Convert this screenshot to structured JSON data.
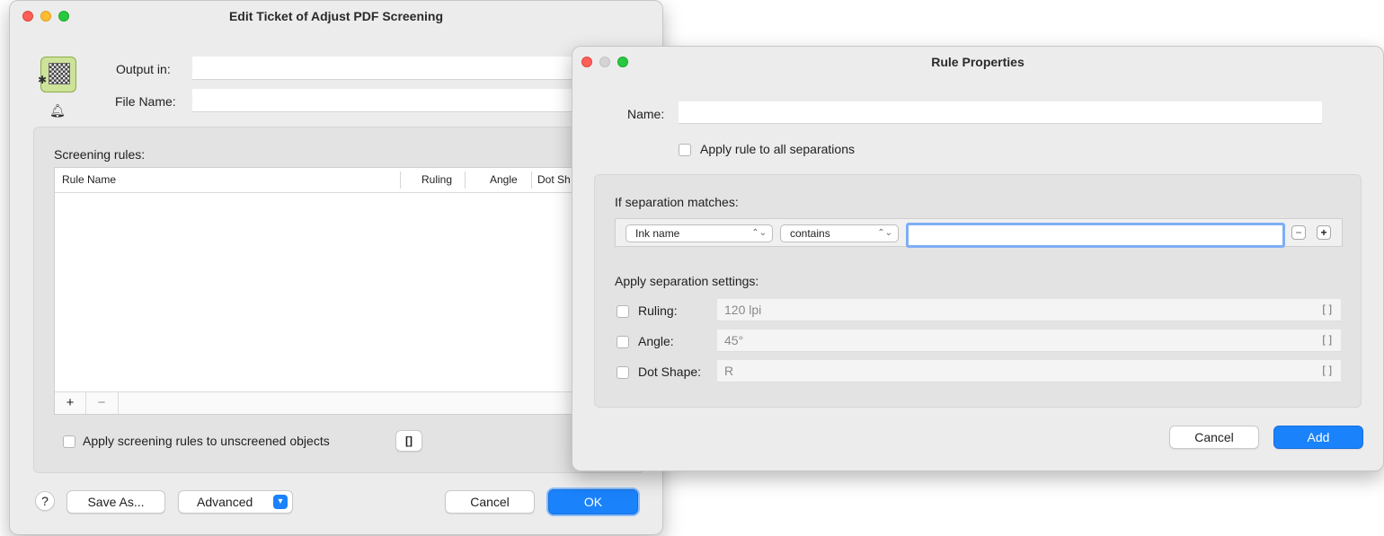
{
  "edit_ticket": {
    "title": "Edit Ticket of Adjust PDF Screening",
    "output_in_label": "Output in:",
    "output_in_value": "",
    "file_name_label": "File Name:",
    "file_name_value": "",
    "screening_rules_label": "Screening rules:",
    "table": {
      "columns": [
        "Rule Name",
        "Ruling",
        "Angle",
        "Dot Sh"
      ],
      "rows": []
    },
    "add_label": "+",
    "remove_label": "−",
    "apply_unscreened_label": "Apply screening rules to unscreened objects",
    "variable_label": "[]",
    "help_label": "?",
    "save_as_label": "Save As...",
    "advanced_label": "Advanced",
    "cancel_label": "Cancel",
    "ok_label": "OK"
  },
  "rule_properties": {
    "title": "Rule Properties",
    "name_label": "Name:",
    "name_value": "",
    "apply_all_label": "Apply rule to all separations",
    "if_matches_label": "If separation matches:",
    "match_field_options_selected": "Ink name",
    "match_operator_selected": "contains",
    "match_value": "",
    "minus_label": "−",
    "plus_label": "+",
    "apply_settings_label": "Apply separation settings:",
    "settings": [
      {
        "label": "Ruling:",
        "value": "120 lpi",
        "var": "[]"
      },
      {
        "label": "Angle:",
        "value": "45°",
        "var": "[]"
      },
      {
        "label": "Dot Shape:",
        "value": "R",
        "var": "[]"
      }
    ],
    "cancel_label": "Cancel",
    "add_label": "Add"
  },
  "colors": {
    "accent": "#1a82fb",
    "close": "#fe5f57",
    "minimize": "#febc2e",
    "zoom": "#28c840"
  }
}
